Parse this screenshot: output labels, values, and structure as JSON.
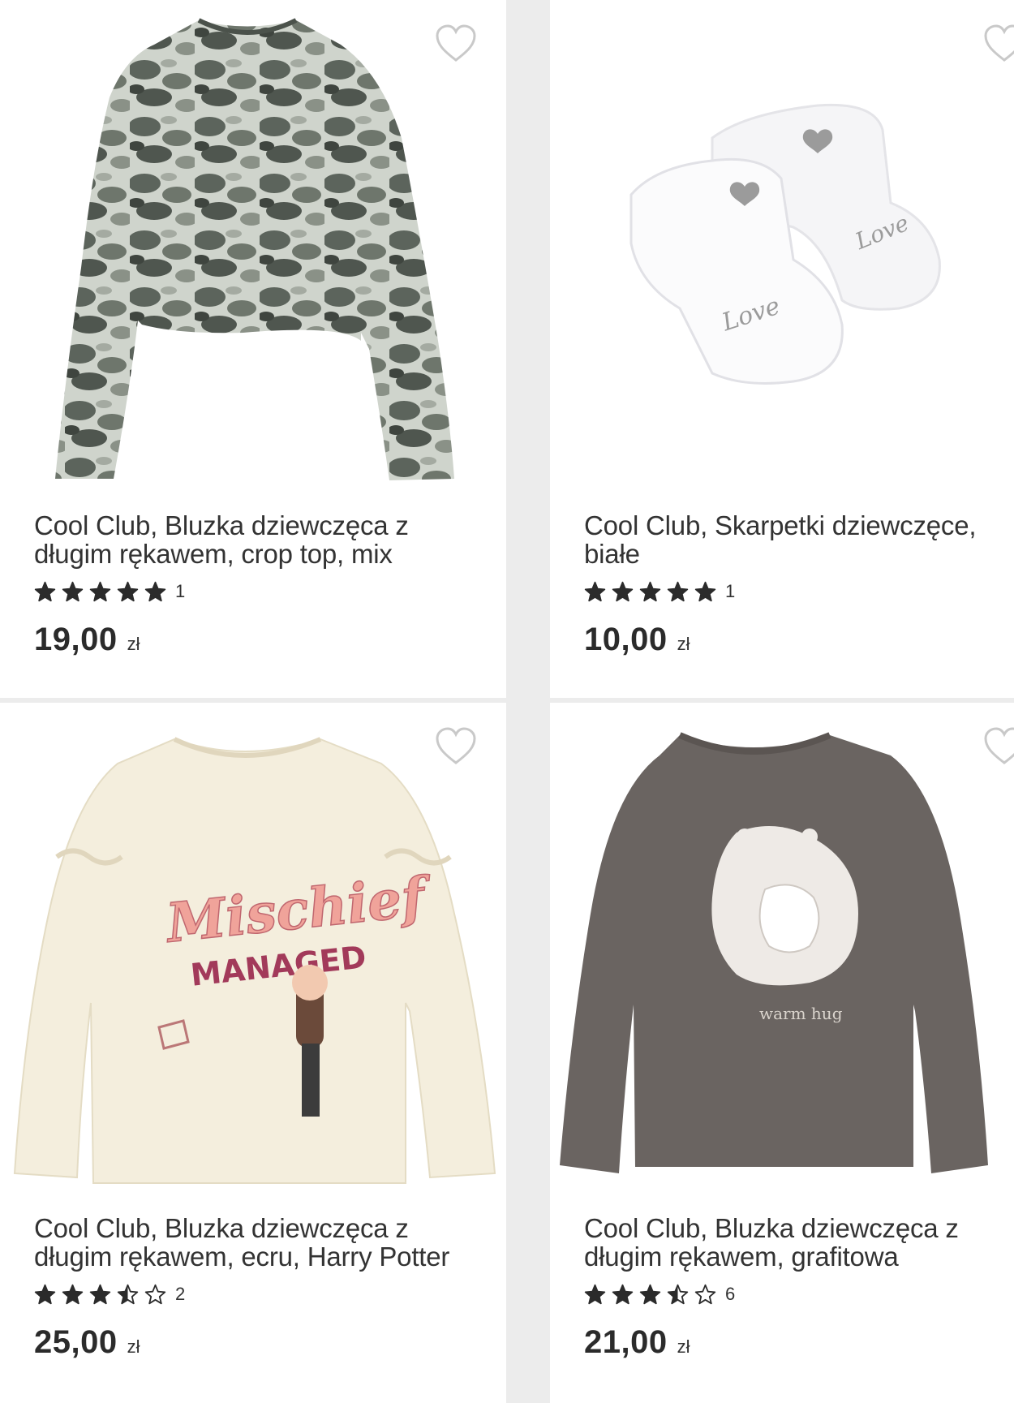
{
  "products": [
    {
      "title": "Cool Club, Bluzka dziewczęca z długim rękawem, crop top, mix",
      "rating": 5,
      "rating_count": "1",
      "price": "19,00",
      "currency": "zł",
      "image_icon": "camo-longsleeve-crop-top-image"
    },
    {
      "title": "Cool Club, Skarpetki dziewczęce, białe",
      "rating": 5,
      "rating_count": "1",
      "price": "10,00",
      "currency": "zł",
      "image_icon": "white-baby-socks-image",
      "image_text": "Love"
    },
    {
      "title": "Cool Club, Bluzka dziewczęca z długim rękawem, ecru, Harry Potter",
      "rating": 3.5,
      "rating_count": "2",
      "price": "25,00",
      "currency": "zł",
      "image_icon": "ecru-harry-potter-longsleeve-image",
      "image_text_1": "Mischief",
      "image_text_2": "MANAGED"
    },
    {
      "title": "Cool Club, Bluzka dziewczęca z długim rękawem, grafitowa",
      "rating": 3.5,
      "rating_count": "6",
      "price": "21,00",
      "currency": "zł",
      "image_icon": "graphite-bear-longsleeve-image",
      "image_text": "warm hug"
    }
  ],
  "colors": {
    "page_background": "#ececec",
    "card_background": "#ffffff",
    "text": "#333333",
    "star": "#2b2b2b",
    "heart_outline": "#c9c9c9"
  }
}
